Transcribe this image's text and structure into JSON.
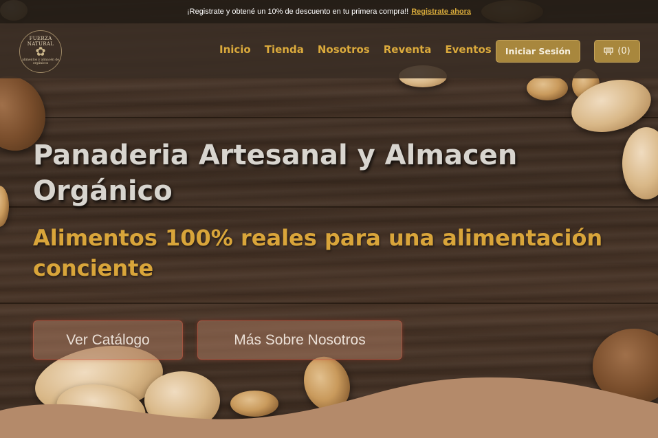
{
  "promo": {
    "text": "¡Registrate y obtené un 10% de descuento en tu primera compra!!",
    "link": "Registrate ahora"
  },
  "logo": {
    "top_text": "FUERZA NATURAL",
    "bottom_text": "alimentos y almacén de orgánicos"
  },
  "nav": {
    "items": [
      {
        "label": "Inicio"
      },
      {
        "label": "Tienda"
      },
      {
        "label": "Nosotros"
      },
      {
        "label": "Reventa"
      },
      {
        "label": "Eventos"
      }
    ],
    "login_label": "Iniciar Sesión",
    "cart_count": "(0)"
  },
  "hero": {
    "title": "Panaderia Artesanal y Almacen Orgánico",
    "subtitle": "Alimentos 100% reales para una alimentación conciente",
    "button_catalog": "Ver Catálogo",
    "button_about": "Más Sobre Nosotros"
  },
  "colors": {
    "accent": "#d9a53a",
    "button": "#a8873d",
    "wave": "#b48a6a"
  },
  "icons": {
    "cart": "cart-icon",
    "logo": "leaf-icon"
  }
}
